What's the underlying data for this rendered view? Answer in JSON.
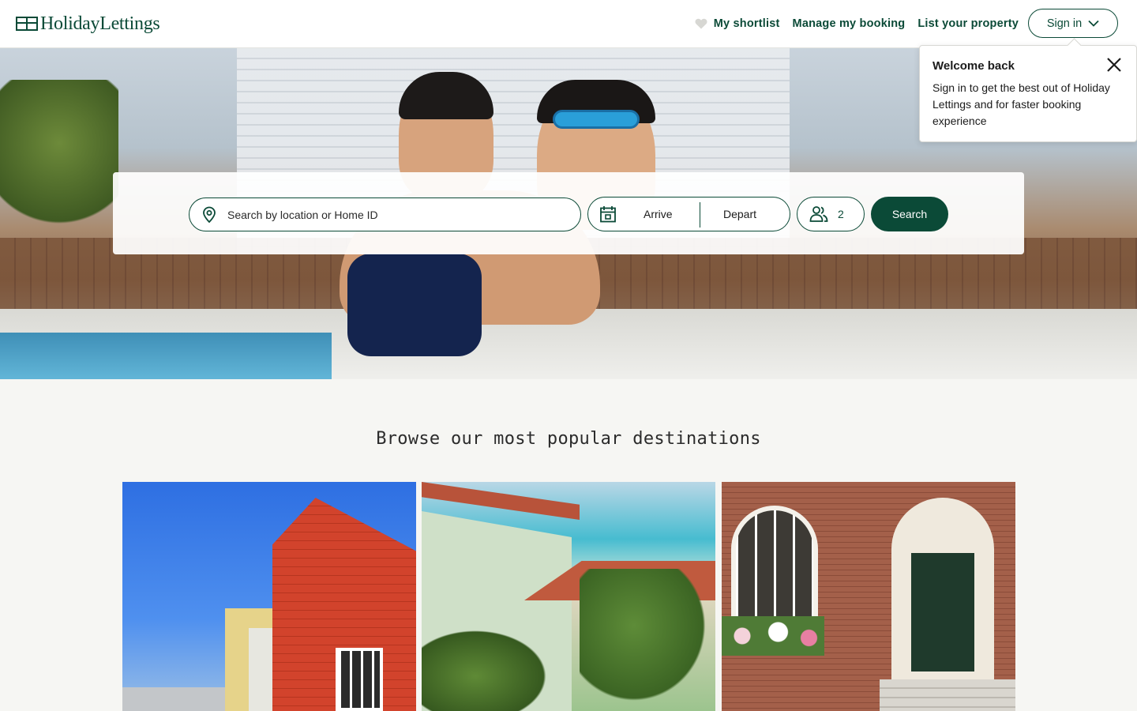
{
  "brand": {
    "name": "HolidayLettings",
    "color": "#0b4a37"
  },
  "nav": {
    "shortlist": "My shortlist",
    "manage_booking": "Manage my booking",
    "list_property": "List your property",
    "sign_in": "Sign in"
  },
  "search": {
    "location_placeholder": "Search by location or Home ID",
    "arrive": "Arrive",
    "depart": "Depart",
    "guests": "2",
    "button": "Search"
  },
  "popover": {
    "title": "Welcome back",
    "body": "Sign in to get the best out of Holiday Lettings and for faster booking experience"
  },
  "browse": {
    "title": "Browse our most popular destinations"
  },
  "icons": {
    "heart": "heart-icon",
    "chevron": "chevron-down-icon",
    "pin": "location-pin-icon",
    "calendar": "calendar-icon",
    "people": "people-icon",
    "close": "close-icon"
  }
}
